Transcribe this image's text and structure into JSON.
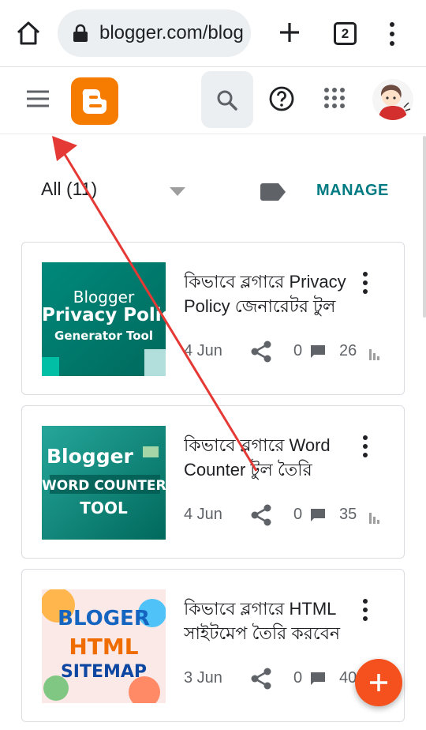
{
  "browser": {
    "url": "blogger.com/blog",
    "tab_count": "2"
  },
  "header": {
    "logo": "B"
  },
  "filter": {
    "label": "All (11)",
    "manage_label": "MANAGE"
  },
  "posts": [
    {
      "title": "কিভাবে ব্লগারে Privacy Policy জেনারেটর টুল তৈরি করবেন",
      "date": "4 Jun",
      "comments": "0",
      "views": "26",
      "thumbnail": {
        "line1": "Blogger",
        "line2": "Privacy Policy",
        "line3": "Generator Tool"
      }
    },
    {
      "title": "কিভাবে ব্লগারে Word Counter টুল তৈরি করবেন",
      "date": "4 Jun",
      "comments": "0",
      "views": "35",
      "thumbnail": {
        "line1": "Blogger",
        "line2": "WORD COUNTER",
        "line3": "TOOL"
      }
    },
    {
      "title": "কিভাবে ব্লগারে HTML সাইটমেপ তৈরি করবেন",
      "date": "3 Jun",
      "comments": "0",
      "views": "40",
      "thumbnail": {
        "line1": "BLOGER",
        "line2": "HTML",
        "line3": "SITEMAP"
      }
    }
  ],
  "fab": {
    "icon": "plus-icon"
  },
  "colors": {
    "accent": "#007b83",
    "brand": "#f57c00",
    "fab": "#f4511e",
    "annotation": "#e53935"
  }
}
